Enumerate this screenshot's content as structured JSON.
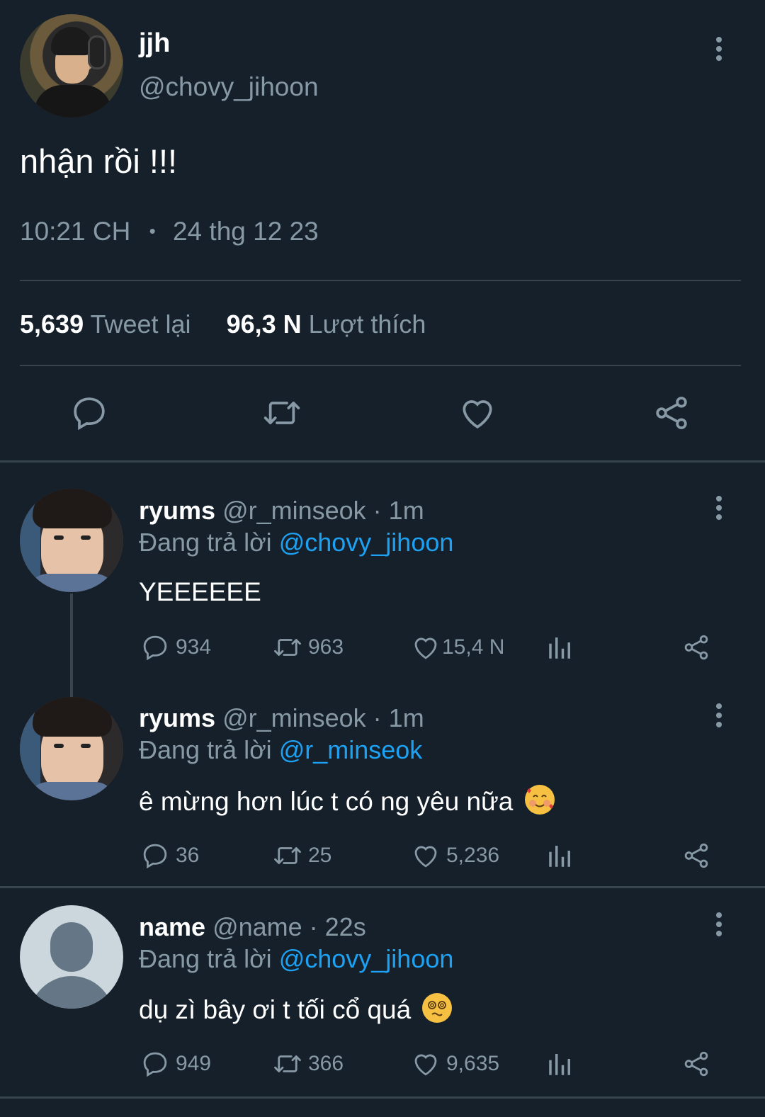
{
  "main_tweet": {
    "name": "jjh",
    "handle": "@chovy_jihoon",
    "text": "nhận rồi !!!",
    "time": "10:21 CH",
    "separator": "•",
    "date": "24 thg 12 23",
    "retweets_count": "5,639",
    "retweets_label": "Tweet lại",
    "likes_count": "96,3 N",
    "likes_label": "Lượt thích"
  },
  "replies": [
    {
      "name": "ryums",
      "meta": "@r_minseok · 1m",
      "replying_label": "Đang trả lời",
      "replying_to": "@chovy_jihoon",
      "text": "YEEEEEE",
      "emoji": "",
      "replies": "934",
      "retweets": "963",
      "likes": "15,4 N"
    },
    {
      "name": "ryums",
      "meta": "@r_minseok · 1m",
      "replying_label": "Đang trả lời",
      "replying_to": "@r_minseok",
      "text": "ê mừng hơn lúc t có ng yêu nữa",
      "emoji": "smiling-face-with-hearts",
      "replies": "36",
      "retweets": "25",
      "likes": "5,236"
    },
    {
      "name": "name",
      "meta": "@name · 22s",
      "replying_label": "Đang trả lời",
      "replying_to": "@chovy_jihoon",
      "text": "dụ zì bây ơi t tối cổ quá",
      "emoji": "dizzy-face",
      "replies": "949",
      "retweets": "366",
      "likes": "9,635"
    }
  ],
  "colors": {
    "background": "#15202b",
    "secondary_text": "#8899a6",
    "mention": "#1da1f2",
    "divider": "#38444d"
  }
}
